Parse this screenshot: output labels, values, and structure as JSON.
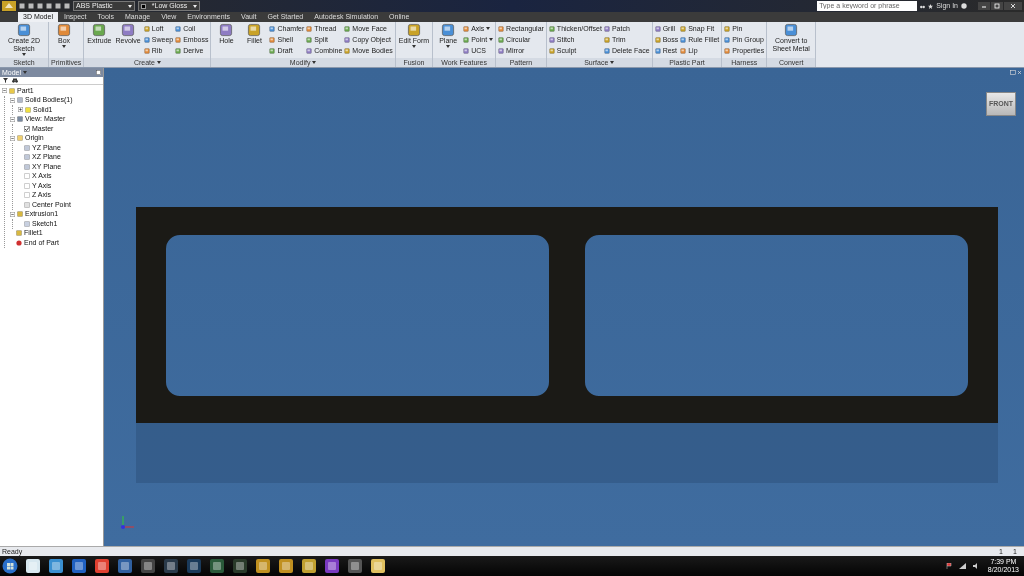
{
  "quick_access": {
    "material": "ABS Plastic",
    "appearance": "*Low Gloss"
  },
  "help": {
    "search_placeholder": "Type a keyword or phrase",
    "sign_in": "Sign In"
  },
  "tabs": [
    {
      "label": "3D Model",
      "selected": true
    },
    {
      "label": "Inspect",
      "selected": false
    },
    {
      "label": "Tools",
      "selected": false
    },
    {
      "label": "Manage",
      "selected": false
    },
    {
      "label": "View",
      "selected": false
    },
    {
      "label": "Environments",
      "selected": false
    },
    {
      "label": "Vault",
      "selected": false
    },
    {
      "label": "Get Started",
      "selected": false
    },
    {
      "label": "Autodesk Simulation",
      "selected": false
    },
    {
      "label": "Online",
      "selected": false
    }
  ],
  "ribbon": [
    {
      "label": "Sketch",
      "menu": false,
      "groups": [
        {
          "kind": "large",
          "label": "Create 2D Sketch",
          "caret": true
        }
      ]
    },
    {
      "label": "Primitives",
      "menu": false,
      "groups": [
        {
          "kind": "large",
          "label": "Box",
          "caret": true
        }
      ]
    },
    {
      "label": "Create",
      "menu": true,
      "groups": [
        {
          "kind": "large",
          "label": "Extrude",
          "caret": false
        },
        {
          "kind": "large",
          "label": "Revolve",
          "caret": false
        },
        {
          "kind": "stack",
          "items": [
            {
              "label": "Loft",
              "caret": false
            },
            {
              "label": "Sweep",
              "caret": false
            },
            {
              "label": "Rib",
              "caret": false
            }
          ]
        },
        {
          "kind": "stack",
          "items": [
            {
              "label": "Coil",
              "caret": false
            },
            {
              "label": "Emboss",
              "caret": false
            },
            {
              "label": "Derive",
              "caret": false
            }
          ]
        }
      ]
    },
    {
      "label": "Modify",
      "menu": true,
      "groups": [
        {
          "kind": "large",
          "label": "Hole",
          "caret": false
        },
        {
          "kind": "large",
          "label": "Fillet",
          "caret": false
        },
        {
          "kind": "stack",
          "items": [
            {
              "label": "Chamfer",
              "caret": false
            },
            {
              "label": "Shell",
              "caret": false
            },
            {
              "label": "Draft",
              "caret": false
            }
          ]
        },
        {
          "kind": "stack",
          "items": [
            {
              "label": "Thread",
              "caret": false
            },
            {
              "label": "Split",
              "caret": false
            },
            {
              "label": "Combine",
              "caret": false
            }
          ]
        },
        {
          "kind": "stack",
          "items": [
            {
              "label": "Move Face",
              "caret": false
            },
            {
              "label": "Copy Object",
              "caret": false
            },
            {
              "label": "Move Bodies",
              "caret": false
            }
          ]
        }
      ]
    },
    {
      "label": "Fusion",
      "menu": false,
      "groups": [
        {
          "kind": "large",
          "label": "Edit Form",
          "caret": true
        }
      ]
    },
    {
      "label": "Work Features",
      "menu": false,
      "groups": [
        {
          "kind": "large",
          "label": "Plane",
          "caret": true
        },
        {
          "kind": "stack",
          "items": [
            {
              "label": "Axis",
              "caret": true
            },
            {
              "label": "Point",
              "caret": true
            },
            {
              "label": "UCS",
              "caret": false
            }
          ]
        }
      ]
    },
    {
      "label": "Pattern",
      "menu": false,
      "groups": [
        {
          "kind": "stack",
          "items": [
            {
              "label": "Rectangular",
              "caret": false
            },
            {
              "label": "Circular",
              "caret": false
            },
            {
              "label": "Mirror",
              "caret": false
            }
          ]
        }
      ]
    },
    {
      "label": "Surface",
      "menu": true,
      "groups": [
        {
          "kind": "stack",
          "items": [
            {
              "label": "Thicken/Offset",
              "caret": false
            },
            {
              "label": "Stitch",
              "caret": false
            },
            {
              "label": "Sculpt",
              "caret": false
            }
          ]
        },
        {
          "kind": "stack",
          "items": [
            {
              "label": "Patch",
              "caret": false
            },
            {
              "label": "Trim",
              "caret": false
            },
            {
              "label": "Delete Face",
              "caret": false
            }
          ]
        }
      ]
    },
    {
      "label": "Plastic Part",
      "menu": false,
      "groups": [
        {
          "kind": "stack",
          "items": [
            {
              "label": "Grill",
              "caret": false
            },
            {
              "label": "Boss",
              "caret": false
            },
            {
              "label": "Rest",
              "caret": false
            }
          ]
        },
        {
          "kind": "stack",
          "items": [
            {
              "label": "Snap Fit",
              "caret": false
            },
            {
              "label": "Rule Fillet",
              "caret": false
            },
            {
              "label": "Lip",
              "caret": false
            }
          ]
        }
      ]
    },
    {
      "label": "Harness",
      "menu": false,
      "groups": [
        {
          "kind": "stack",
          "items": [
            {
              "label": "Pin",
              "caret": false
            },
            {
              "label": "Pin Group",
              "caret": false
            },
            {
              "label": "Properties",
              "caret": false
            }
          ]
        }
      ]
    },
    {
      "label": "Convert",
      "menu": false,
      "groups": [
        {
          "kind": "large",
          "label": "Convert to Sheet Metal",
          "caret": false
        }
      ]
    }
  ],
  "browser": {
    "title": "Model",
    "tree": [
      {
        "label": "Part1",
        "kind": "part",
        "expanded": true,
        "children": [
          {
            "label": "Solid Bodies(1)",
            "kind": "bodies",
            "expanded": true,
            "children": [
              {
                "label": "Solid1",
                "kind": "body",
                "expanded": false
              }
            ]
          },
          {
            "label": "View: Master",
            "kind": "view",
            "expanded": true,
            "children": [
              {
                "label": "Master",
                "kind": "check",
                "checked": true
              }
            ]
          },
          {
            "label": "Origin",
            "kind": "folder",
            "expanded": true,
            "children": [
              {
                "label": "YZ Plane",
                "kind": "plane"
              },
              {
                "label": "XZ Plane",
                "kind": "plane"
              },
              {
                "label": "XY Plane",
                "kind": "plane"
              },
              {
                "label": "X Axis",
                "kind": "axis"
              },
              {
                "label": "Y Axis",
                "kind": "axis"
              },
              {
                "label": "Z Axis",
                "kind": "axis"
              },
              {
                "label": "Center Point",
                "kind": "point"
              }
            ]
          },
          {
            "label": "Extrusion1",
            "kind": "feature",
            "expanded": true,
            "children": [
              {
                "label": "Sketch1",
                "kind": "sketch"
              }
            ]
          },
          {
            "label": "Fillet1",
            "kind": "feature"
          },
          {
            "label": "End of Part",
            "kind": "end"
          }
        ]
      }
    ]
  },
  "viewcube": {
    "face": "FRONT"
  },
  "status_bar": {
    "message": "Ready",
    "counts": [
      "1",
      "1"
    ]
  },
  "clock": {
    "time": "7:39 PM",
    "date": "8/20/2013"
  }
}
